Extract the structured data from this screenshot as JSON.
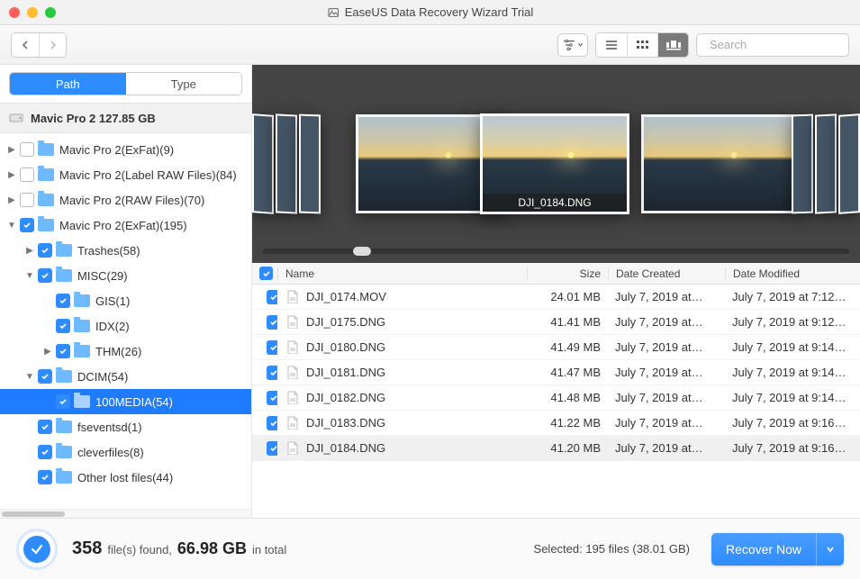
{
  "window": {
    "title": "EaseUS Data Recovery Wizard Trial"
  },
  "toolbar": {
    "search_placeholder": "Search"
  },
  "tabs": {
    "path": "Path",
    "type": "Type"
  },
  "disk": {
    "label": "Mavic Pro 2 127.85 GB"
  },
  "tree": [
    {
      "indent": 0,
      "disclosure": "▶",
      "checked": false,
      "label": "Mavic Pro 2(ExFat)(9)"
    },
    {
      "indent": 0,
      "disclosure": "▶",
      "checked": false,
      "label": "Mavic Pro 2(Label RAW Files)(84)"
    },
    {
      "indent": 0,
      "disclosure": "▶",
      "checked": false,
      "label": "Mavic Pro 2(RAW Files)(70)"
    },
    {
      "indent": 0,
      "disclosure": "▼",
      "checked": true,
      "label": "Mavic Pro 2(ExFat)(195)"
    },
    {
      "indent": 1,
      "disclosure": "▶",
      "checked": true,
      "label": "Trashes(58)"
    },
    {
      "indent": 1,
      "disclosure": "▼",
      "checked": true,
      "label": "MISC(29)"
    },
    {
      "indent": 2,
      "disclosure": "",
      "checked": true,
      "label": "GIS(1)"
    },
    {
      "indent": 2,
      "disclosure": "",
      "checked": true,
      "label": "IDX(2)"
    },
    {
      "indent": 2,
      "disclosure": "▶",
      "checked": true,
      "label": "THM(26)"
    },
    {
      "indent": 1,
      "disclosure": "▼",
      "checked": true,
      "label": "DCIM(54)"
    },
    {
      "indent": 2,
      "disclosure": "",
      "checked": true,
      "label": "100MEDIA(54)",
      "selected": true
    },
    {
      "indent": 1,
      "disclosure": "",
      "checked": true,
      "label": "fseventsd(1)"
    },
    {
      "indent": 1,
      "disclosure": "",
      "checked": true,
      "label": "cleverfiles(8)"
    },
    {
      "indent": 1,
      "disclosure": "",
      "checked": true,
      "label": "Other lost files(44)"
    }
  ],
  "coverflow": {
    "caption": "DJI_0184.DNG"
  },
  "columns": {
    "name": "Name",
    "size": "Size",
    "dc": "Date Created",
    "dm": "Date Modified"
  },
  "files": [
    {
      "name": "DJI_0174.MOV",
      "size": "24.01 MB",
      "dc": "July 7, 2019 at…",
      "dm": "July 7, 2019 at 7:12…",
      "sel": false
    },
    {
      "name": "DJI_0175.DNG",
      "size": "41.41 MB",
      "dc": "July 7, 2019 at…",
      "dm": "July 7, 2019 at 9:12…",
      "sel": false
    },
    {
      "name": "DJI_0180.DNG",
      "size": "41.49 MB",
      "dc": "July 7, 2019 at…",
      "dm": "July 7, 2019 at 9:14…",
      "sel": false
    },
    {
      "name": "DJI_0181.DNG",
      "size": "41.47 MB",
      "dc": "July 7, 2019 at…",
      "dm": "July 7, 2019 at 9:14…",
      "sel": false
    },
    {
      "name": "DJI_0182.DNG",
      "size": "41.48 MB",
      "dc": "July 7, 2019 at…",
      "dm": "July 7, 2019 at 9:14…",
      "sel": false
    },
    {
      "name": "DJI_0183.DNG",
      "size": "41.22 MB",
      "dc": "July 7, 2019 at…",
      "dm": "July 7, 2019 at 9:16…",
      "sel": false
    },
    {
      "name": "DJI_0184.DNG",
      "size": "41.20 MB",
      "dc": "July 7, 2019 at…",
      "dm": "July 7, 2019 at 9:16…",
      "sel": true
    }
  ],
  "footer": {
    "count": "358",
    "count_suffix": "file(s) found,",
    "size": "66.98 GB",
    "size_suffix": "in total",
    "selected": "Selected: 195 files (38.01 GB)",
    "recover": "Recover Now"
  }
}
